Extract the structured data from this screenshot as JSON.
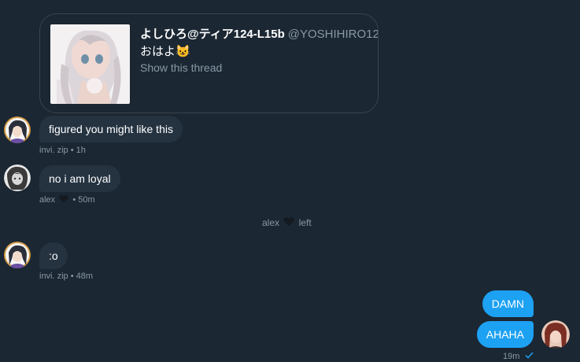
{
  "shared_tweet": {
    "display_name": "よしひろ@ティア124-L15b",
    "handle": "@YOSHIHIRO12...",
    "text": "おはよ😺",
    "show_thread": "Show this thread"
  },
  "messages": [
    {
      "sender": "invi. zip",
      "text": "figured you might like this",
      "time": "1h"
    },
    {
      "sender": "alex",
      "text": "no i am loyal",
      "time": "50m"
    },
    {
      "sender": "invi. zip",
      "text": ":o",
      "time": "48m"
    }
  ],
  "system": {
    "user": "alex",
    "action": "left"
  },
  "outgoing": [
    {
      "text": "DAMN"
    },
    {
      "text": "AHAHA"
    }
  ],
  "outgoing_meta": {
    "time": "19m"
  },
  "separator": "•",
  "colors": {
    "background": "#1b2733",
    "incoming_bubble": "#253341",
    "outgoing_bubble": "#1da1f2",
    "muted_text": "#8899a6",
    "card_border": "#3a444c"
  }
}
